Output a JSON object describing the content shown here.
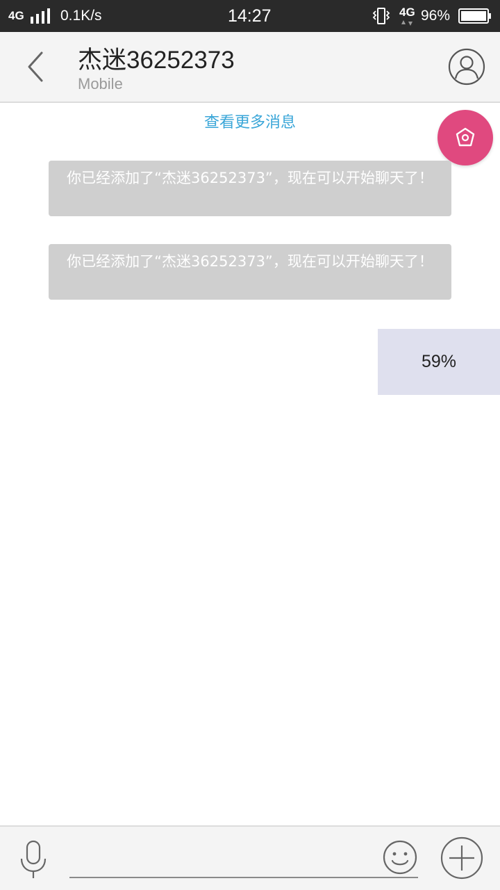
{
  "status_bar": {
    "network": "4G",
    "speed": "0.1K/s",
    "time": "14:27",
    "network2": "4G",
    "battery": "96%"
  },
  "header": {
    "title": "杰迷36252373",
    "subtitle": "Mobile",
    "back_icon": "chevron-left-icon",
    "profile_icon": "user-circle-icon"
  },
  "chat": {
    "load_more": "查看更多消息",
    "messages": [
      {
        "type": "system",
        "text": "你已经添加了“杰迷36252373”，现在可以开始聊天了！"
      },
      {
        "type": "system",
        "text": "你已经添加了“杰迷36252373”，现在可以开始聊天了！"
      },
      {
        "type": "upload",
        "progress_text": "59%",
        "progress": 0.59
      }
    ],
    "float_button_icon": "flower-icon"
  },
  "input_bar": {
    "mic_icon": "microphone-icon",
    "input_value": "",
    "emoji_icon": "smiley-icon",
    "plus_icon": "plus-circle-icon"
  },
  "colors": {
    "status_bg": "#2a2a2a",
    "header_bg": "#f4f4f4",
    "link": "#3aa6d8",
    "float_button": "#e0497f",
    "system_bubble": "#cfcfcf",
    "upload_bubble": "#dfe0ee"
  }
}
